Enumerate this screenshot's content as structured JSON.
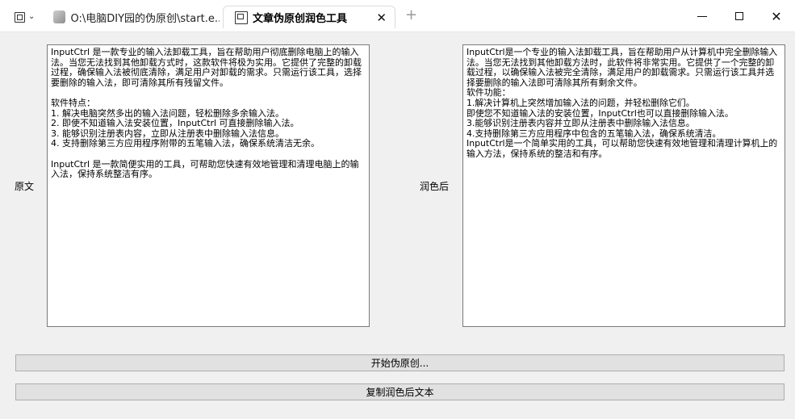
{
  "titlebar": {
    "tabs": [
      {
        "label": "O:\\电脑DIY园的伪原创\\start.e...",
        "icon": "app-file-icon",
        "active": false
      },
      {
        "label": "文章伪原创润色工具",
        "icon": "window-app-icon",
        "active": true
      }
    ],
    "close_tab_glyph": "✕",
    "new_tab_glyph": "+",
    "window_controls": {
      "close_glyph": "✕"
    }
  },
  "left": {
    "label": "原文",
    "text": "InputCtrl 是一款专业的输入法卸载工具，旨在帮助用户彻底删除电脑上的输入法。当您无法找到其他卸载方式时，这款软件将极为实用。它提供了完整的卸载过程，确保输入法被彻底清除，满足用户对卸载的需求。只需运行该工具，选择要删除的输入法，即可清除其所有残留文件。\n\n软件特点：\n1. 解决电脑突然多出的输入法问题，轻松删除多余输入法。\n2. 即使不知道输入法安装位置，InputCtrl 可直接删除输入法。\n3. 能够识别注册表内容，立即从注册表中删除输入法信息。\n4. 支持删除第三方应用程序附带的五笔输入法，确保系统清洁无余。\n\nInputCtrl 是一款简便实用的工具，可帮助您快速有效地管理和清理电脑上的输入法，保持系统整洁有序。"
  },
  "right": {
    "label": "润色后",
    "text": "InputCtrl是一个专业的输入法卸载工具，旨在帮助用户从计算机中完全删除输入法。当您无法找到其他卸载方法时，此软件将非常实用。它提供了一个完整的卸载过程，以确保输入法被完全清除，满足用户的卸载需求。只需运行该工具并选择要删除的输入法即可清除其所有剩余文件。\n软件功能：\n1.解决计算机上突然增加输入法的问题，并轻松删除它们。\n即使您不知道输入法的安装位置，InputCtrl也可以直接删除输入法。\n3.能够识别注册表内容并立即从注册表中删除输入法信息。\n4.支持删除第三方应用程序中包含的五笔输入法，确保系统清洁。\nInputCtrl是一个简单实用的工具，可以帮助您快速有效地管理和清理计算机上的输入方法，保持系统的整洁和有序。"
  },
  "buttons": {
    "start_label": "开始伪原创...",
    "copy_label": "复制润色后文本"
  }
}
